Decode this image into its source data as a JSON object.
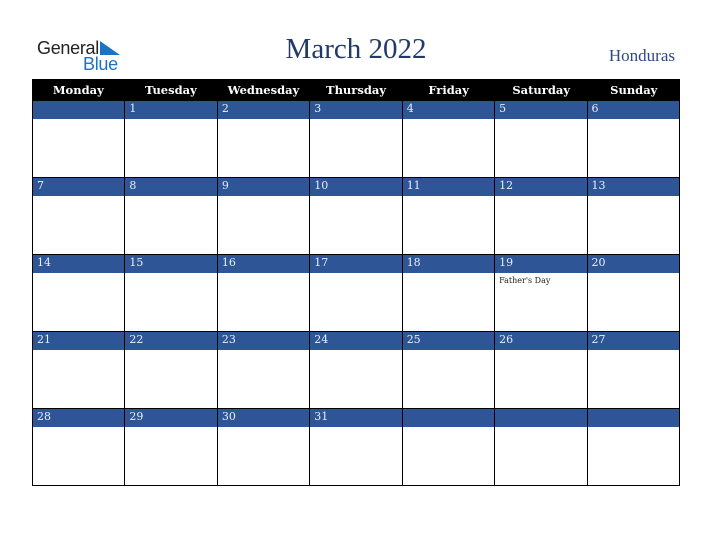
{
  "logo": {
    "line1": "General",
    "line2": "Blue",
    "icon": "triangle-flag-icon",
    "color": "#1a73c4"
  },
  "title": "March 2022",
  "country": "Honduras",
  "colors": {
    "header_bg": "#000000",
    "date_bar": "#2e5596",
    "title": "#223a68"
  },
  "weekdays": [
    "Monday",
    "Tuesday",
    "Wednesday",
    "Thursday",
    "Friday",
    "Saturday",
    "Sunday"
  ],
  "weeks": [
    [
      {
        "day": ""
      },
      {
        "day": "1"
      },
      {
        "day": "2"
      },
      {
        "day": "3"
      },
      {
        "day": "4"
      },
      {
        "day": "5"
      },
      {
        "day": "6"
      }
    ],
    [
      {
        "day": "7"
      },
      {
        "day": "8"
      },
      {
        "day": "9"
      },
      {
        "day": "10"
      },
      {
        "day": "11"
      },
      {
        "day": "12"
      },
      {
        "day": "13"
      }
    ],
    [
      {
        "day": "14"
      },
      {
        "day": "15"
      },
      {
        "day": "16"
      },
      {
        "day": "17"
      },
      {
        "day": "18"
      },
      {
        "day": "19",
        "event": "Father's Day"
      },
      {
        "day": "20"
      }
    ],
    [
      {
        "day": "21"
      },
      {
        "day": "22"
      },
      {
        "day": "23"
      },
      {
        "day": "24"
      },
      {
        "day": "25"
      },
      {
        "day": "26"
      },
      {
        "day": "27"
      }
    ],
    [
      {
        "day": "28"
      },
      {
        "day": "29"
      },
      {
        "day": "30"
      },
      {
        "day": "31"
      },
      {
        "day": ""
      },
      {
        "day": ""
      },
      {
        "day": ""
      }
    ]
  ]
}
